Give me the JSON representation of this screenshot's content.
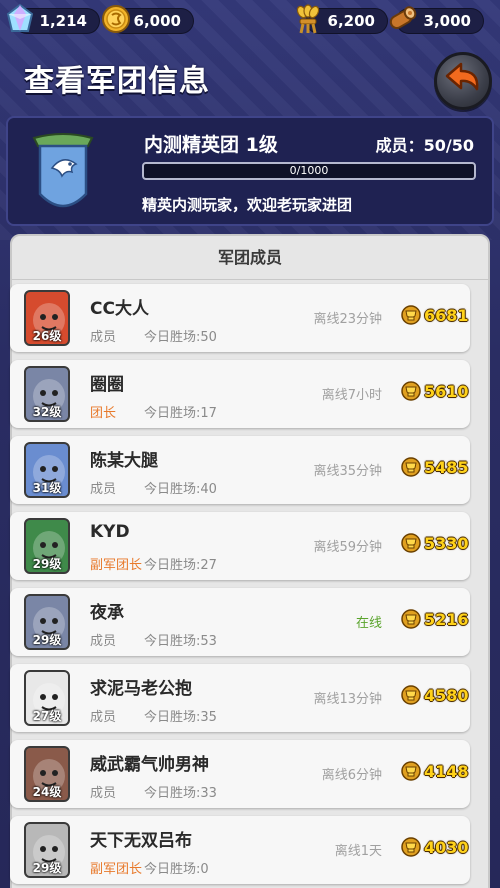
{
  "resources": {
    "gem": "1,214",
    "coin": "6,000",
    "wheat": "6,200",
    "wood": "3,000"
  },
  "page": {
    "title": "查看军团信息"
  },
  "guild": {
    "name": "内测精英团 1级",
    "members": "成员：50/50",
    "progress_text": "0/1000",
    "progress": 0,
    "description": "精英内测玩家，欢迎老玩家进团"
  },
  "members_panel": {
    "header": "军团成员"
  },
  "members": [
    {
      "name": "CC大人",
      "level": "26级",
      "role": "成员",
      "wins": "今日胜场:50",
      "status": "离线23分钟",
      "score": "6681",
      "avatar_color": "#d64b2e"
    },
    {
      "name": "圈圈",
      "level": "32级",
      "role": "团长",
      "wins": "今日胜场:17",
      "status": "离线7小时",
      "score": "5610",
      "avatar_color": "#7a86a6"
    },
    {
      "name": "陈某大腿",
      "level": "31级",
      "role": "成员",
      "wins": "今日胜场:40",
      "status": "离线35分钟",
      "score": "5485",
      "avatar_color": "#6a8dd0"
    },
    {
      "name": "KYD",
      "level": "29级",
      "role": "副军团长",
      "wins": "今日胜场:27",
      "status": "离线59分钟",
      "score": "5330",
      "avatar_color": "#3f8a4a"
    },
    {
      "name": "夜承",
      "level": "29级",
      "role": "成员",
      "wins": "今日胜场:53",
      "status": "在线",
      "score": "5216",
      "avatar_color": "#7a86a6"
    },
    {
      "name": "求泥马老公抱",
      "level": "27级",
      "role": "成员",
      "wins": "今日胜场:35",
      "status": "离线13分钟",
      "score": "4580",
      "avatar_color": "#e8e8e8"
    },
    {
      "name": "威武霸气帅男神",
      "level": "24级",
      "role": "成员",
      "wins": "今日胜场:33",
      "status": "离线6分钟",
      "score": "4148",
      "avatar_color": "#8a5a4a"
    },
    {
      "name": "天下无双吕布",
      "level": "29级",
      "role": "副军团长",
      "wins": "今日胜场:0",
      "status": "离线1天",
      "score": "4030",
      "avatar_color": "#b8b8b8"
    }
  ],
  "colors": {
    "accent_gold": "#ffd21a",
    "leader_orange": "#e87a2c",
    "online_green": "#5aa42c"
  }
}
